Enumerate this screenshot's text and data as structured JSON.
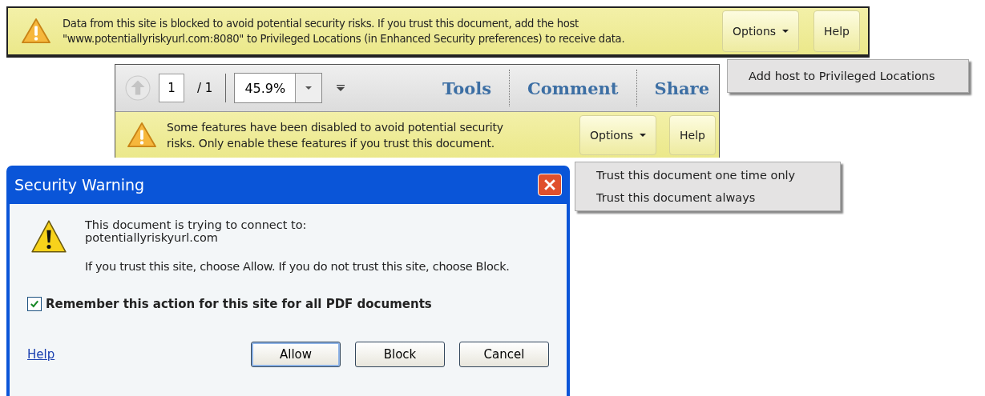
{
  "host_bar": {
    "message_lines": [
      "Data from this site is blocked to avoid potential security risks. If you trust this document, add the host",
      "\"www.potentiallyriskyurl.com:8080\" to Privileged Locations (in Enhanced Security preferences) to receive data."
    ],
    "options_button": "Options",
    "help_button": "Help",
    "menu": [
      "Add host to Privileged Locations"
    ]
  },
  "toolbar": {
    "page": "1",
    "page_total": "/ 1",
    "zoom": "45.9%",
    "links": [
      "Tools",
      "Comment",
      "Share"
    ]
  },
  "features_bar": {
    "message_lines": [
      "Some features have been disabled to avoid potential security",
      "risks. Only enable these features if you trust this document."
    ],
    "options_button": "Options",
    "help_button": "Help",
    "menu": [
      "Trust this document one time only",
      "Trust this document always"
    ]
  },
  "dialog": {
    "title": "Security Warning",
    "message": "This document is trying to connect to:",
    "url": "potentiallyriskyurl.com",
    "advice": "If you trust this site, choose Allow. If you do not trust this site, choose Block.",
    "remember": {
      "label": "Remember this action for this site for all PDF documents",
      "checked": true
    },
    "help_link": "Help",
    "buttons": [
      {
        "label": "Allow",
        "default": true
      },
      {
        "label": "Block",
        "default": false
      },
      {
        "label": "Cancel",
        "default": false
      }
    ]
  }
}
